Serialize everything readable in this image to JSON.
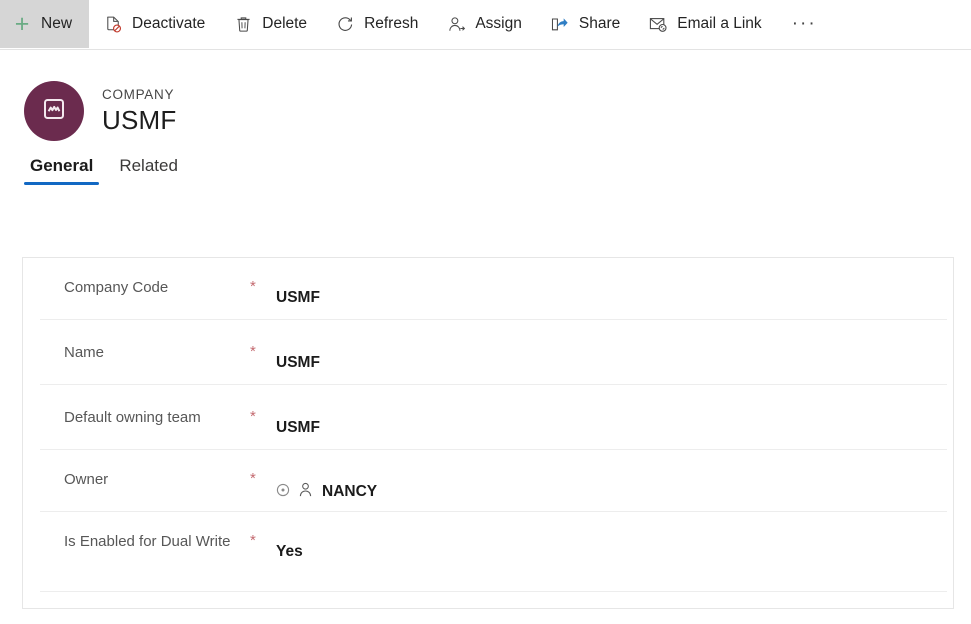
{
  "commandbar": {
    "items": [
      {
        "label": "New",
        "icon": "plus-icon",
        "state": "highlighted"
      },
      {
        "label": "Deactivate",
        "icon": "deactivate-icon",
        "state": "normal"
      },
      {
        "label": "Delete",
        "icon": "trash-icon",
        "state": "normal"
      },
      {
        "label": "Refresh",
        "icon": "refresh-icon",
        "state": "normal"
      },
      {
        "label": "Assign",
        "icon": "assign-person-icon",
        "state": "normal"
      },
      {
        "label": "Share",
        "icon": "share-icon",
        "state": "normal"
      },
      {
        "label": "Email a Link",
        "icon": "email-link-icon",
        "state": "normal"
      }
    ],
    "overflow_label": "···"
  },
  "record": {
    "entity_label": "COMPANY",
    "title": "USMF",
    "avatar_icon": "company-entity-icon",
    "avatar_color": "#6b2b4e"
  },
  "tabs": [
    {
      "label": "General",
      "selected": true
    },
    {
      "label": "Related",
      "selected": false
    }
  ],
  "tab_accent_color": "#1268c3",
  "form": {
    "required_marker": "*",
    "fields": [
      {
        "label": "Company Code",
        "required": true,
        "value": "USMF",
        "type": "text"
      },
      {
        "label": "Name",
        "required": true,
        "value": "USMF",
        "type": "text"
      },
      {
        "label": "Default owning team",
        "required": true,
        "value": "USMF",
        "type": "lookup"
      },
      {
        "label": "Owner",
        "required": true,
        "value": "NANCY",
        "type": "owner-lookup",
        "status_icon": "presence-circle-icon",
        "person_icon": "person-icon"
      },
      {
        "label": "Is Enabled for Dual Write",
        "required": true,
        "value": "Yes",
        "type": "choice"
      }
    ]
  }
}
